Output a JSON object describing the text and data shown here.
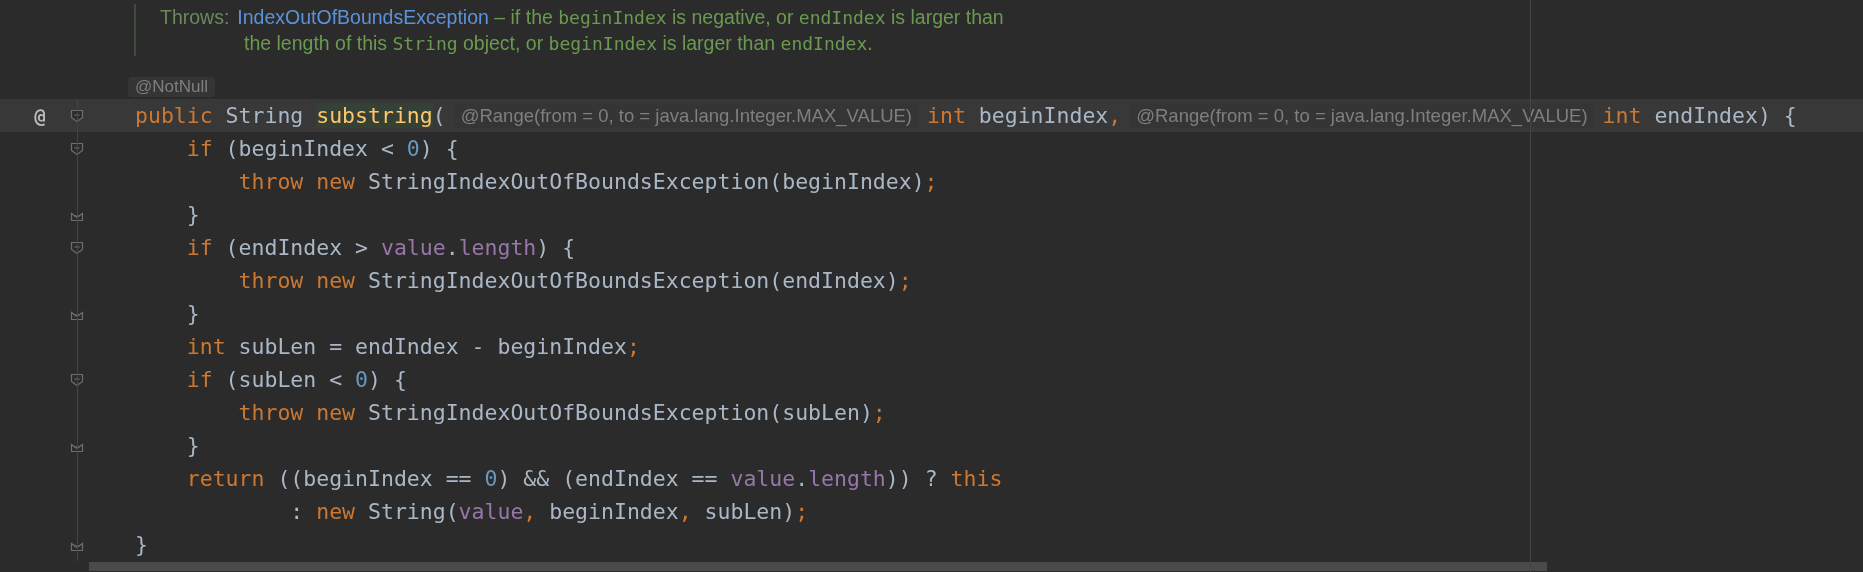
{
  "doc_comment": {
    "lines": [
      [
        {
          "kind": "label",
          "text": "Throws:"
        },
        {
          "kind": "link",
          "text": "IndexOutOfBoundsException"
        },
        {
          "kind": "text",
          "text": " – if the "
        },
        {
          "kind": "code",
          "text": "beginIndex"
        },
        {
          "kind": "text",
          "text": " is negative, or "
        },
        {
          "kind": "code",
          "text": "endIndex"
        },
        {
          "kind": "text",
          "text": " is larger than"
        }
      ],
      [
        {
          "kind": "text",
          "text": "the length of this "
        },
        {
          "kind": "code",
          "text": "String"
        },
        {
          "kind": "text",
          "text": " object, or "
        },
        {
          "kind": "code",
          "text": "beginIndex"
        },
        {
          "kind": "text",
          "text": " is larger than "
        },
        {
          "kind": "code",
          "text": "endIndex"
        },
        {
          "kind": "text",
          "text": "."
        }
      ]
    ]
  },
  "annotation_hint": "@NotNull",
  "code_lines": [
    {
      "marker": "@",
      "fold_start": true,
      "fold_end": false,
      "current": true,
      "tokens": [
        {
          "kind": "kw",
          "text": "public "
        },
        {
          "kind": "plain",
          "text": "String "
        },
        {
          "kind": "match",
          "text": "substring"
        },
        {
          "kind": "plain",
          "text": "("
        },
        {
          "kind": "hint",
          "text": "@Range(from = 0, to = java.lang.Integer.MAX_VALUE)"
        },
        {
          "kind": "kw",
          "text": "int "
        },
        {
          "kind": "plain",
          "text": "beginIndex"
        },
        {
          "kind": "punct",
          "text": ","
        },
        {
          "kind": "hint",
          "text": "@Range(from = 0, to = java.lang.Integer.MAX_VALUE)"
        },
        {
          "kind": "kw",
          "text": "int "
        },
        {
          "kind": "plain",
          "text": "endIndex) {"
        }
      ]
    },
    {
      "fold_start": true,
      "fold_end": false,
      "current": false,
      "tokens": [
        {
          "kind": "kw",
          "text": "    if "
        },
        {
          "kind": "plain",
          "text": "(beginIndex < "
        },
        {
          "kind": "num",
          "text": "0"
        },
        {
          "kind": "plain",
          "text": ") {"
        }
      ]
    },
    {
      "fold_start": false,
      "fold_end": false,
      "current": false,
      "tokens": [
        {
          "kind": "kw",
          "text": "        throw new "
        },
        {
          "kind": "plain",
          "text": "StringIndexOutOfBoundsException(beginIndex)"
        },
        {
          "kind": "punct",
          "text": ";"
        }
      ]
    },
    {
      "fold_start": false,
      "fold_end": true,
      "current": false,
      "tokens": [
        {
          "kind": "plain",
          "text": "    }"
        }
      ]
    },
    {
      "fold_start": true,
      "fold_end": false,
      "current": false,
      "tokens": [
        {
          "kind": "kw",
          "text": "    if "
        },
        {
          "kind": "plain",
          "text": "(endIndex > "
        },
        {
          "kind": "field",
          "text": "value"
        },
        {
          "kind": "plain",
          "text": "."
        },
        {
          "kind": "field",
          "text": "length"
        },
        {
          "kind": "plain",
          "text": ") {"
        }
      ]
    },
    {
      "fold_start": false,
      "fold_end": false,
      "current": false,
      "tokens": [
        {
          "kind": "kw",
          "text": "        throw new "
        },
        {
          "kind": "plain",
          "text": "StringIndexOutOfBoundsException(endIndex)"
        },
        {
          "kind": "punct",
          "text": ";"
        }
      ]
    },
    {
      "fold_start": false,
      "fold_end": true,
      "current": false,
      "tokens": [
        {
          "kind": "plain",
          "text": "    }"
        }
      ]
    },
    {
      "fold_start": false,
      "fold_end": false,
      "current": false,
      "tokens": [
        {
          "kind": "kw",
          "text": "    int "
        },
        {
          "kind": "plain",
          "text": "subLen = endIndex - beginIndex"
        },
        {
          "kind": "punct",
          "text": ";"
        }
      ]
    },
    {
      "fold_start": true,
      "fold_end": false,
      "current": false,
      "tokens": [
        {
          "kind": "kw",
          "text": "    if "
        },
        {
          "kind": "plain",
          "text": "(subLen < "
        },
        {
          "kind": "num",
          "text": "0"
        },
        {
          "kind": "plain",
          "text": ") {"
        }
      ]
    },
    {
      "fold_start": false,
      "fold_end": false,
      "current": false,
      "tokens": [
        {
          "kind": "kw",
          "text": "        throw new "
        },
        {
          "kind": "plain",
          "text": "StringIndexOutOfBoundsException(subLen)"
        },
        {
          "kind": "punct",
          "text": ";"
        }
      ]
    },
    {
      "fold_start": false,
      "fold_end": true,
      "current": false,
      "tokens": [
        {
          "kind": "plain",
          "text": "    }"
        }
      ]
    },
    {
      "fold_start": false,
      "fold_end": false,
      "current": false,
      "tokens": [
        {
          "kind": "kw",
          "text": "    return "
        },
        {
          "kind": "plain",
          "text": "((beginIndex == "
        },
        {
          "kind": "num",
          "text": "0"
        },
        {
          "kind": "plain",
          "text": ") && (endIndex == "
        },
        {
          "kind": "field",
          "text": "value"
        },
        {
          "kind": "plain",
          "text": "."
        },
        {
          "kind": "field",
          "text": "length"
        },
        {
          "kind": "plain",
          "text": ")) ? "
        },
        {
          "kind": "kw",
          "text": "this"
        }
      ]
    },
    {
      "fold_start": false,
      "fold_end": false,
      "current": false,
      "tokens": [
        {
          "kind": "plain",
          "text": "            : "
        },
        {
          "kind": "kw",
          "text": "new "
        },
        {
          "kind": "plain",
          "text": "String("
        },
        {
          "kind": "field",
          "text": "value"
        },
        {
          "kind": "punct",
          "text": ", "
        },
        {
          "kind": "plain",
          "text": "beginIndex"
        },
        {
          "kind": "punct",
          "text": ", "
        },
        {
          "kind": "plain",
          "text": "subLen)"
        },
        {
          "kind": "punct",
          "text": ";"
        }
      ]
    },
    {
      "fold_start": false,
      "fold_end": true,
      "current": false,
      "tokens": [
        {
          "kind": "plain",
          "text": "}"
        }
      ]
    }
  ]
}
